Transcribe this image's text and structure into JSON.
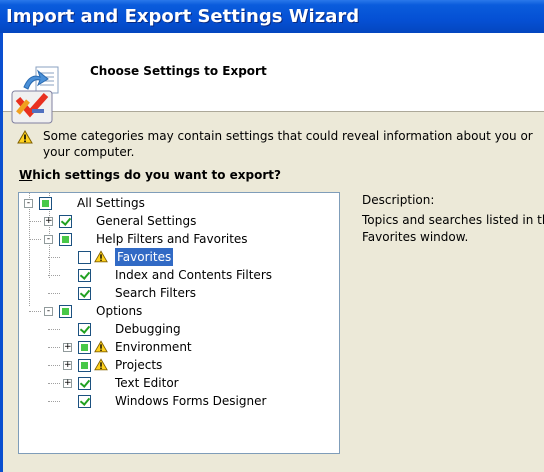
{
  "window": {
    "title": "Import and Export Settings Wizard"
  },
  "header": {
    "title": "Choose Settings to Export",
    "logo_icon": "visual-studio-logo-icon"
  },
  "warning": {
    "icon": "warning-icon",
    "text": "Some categories may contain settings that could reveal information about you or your computer."
  },
  "question": {
    "mnemonic": "W",
    "rest": "hich settings do you want to export?"
  },
  "tree": {
    "nodes": [
      {
        "label": "All Settings",
        "state": "partial",
        "expander": "-",
        "warn": false,
        "level": 0
      },
      {
        "label": "General Settings",
        "state": "checked",
        "expander": "+",
        "warn": false,
        "level": 1
      },
      {
        "label": "Help Filters and Favorites",
        "state": "partial",
        "expander": "-",
        "warn": false,
        "level": 1
      },
      {
        "label": "Favorites",
        "state": "unchecked",
        "expander": "",
        "warn": true,
        "selected": true,
        "level": 2
      },
      {
        "label": "Index and Contents Filters",
        "state": "checked",
        "expander": "",
        "warn": false,
        "level": 2
      },
      {
        "label": "Search Filters",
        "state": "checked",
        "expander": "",
        "warn": false,
        "level": 2
      },
      {
        "label": "Options",
        "state": "partial",
        "expander": "-",
        "warn": false,
        "level": 1
      },
      {
        "label": "Debugging",
        "state": "checked",
        "expander": "",
        "warn": false,
        "level": 2
      },
      {
        "label": "Environment",
        "state": "partial",
        "expander": "+",
        "warn": true,
        "level": 2
      },
      {
        "label": "Projects",
        "state": "partial",
        "expander": "+",
        "warn": true,
        "level": 2
      },
      {
        "label": "Text Editor",
        "state": "checked",
        "expander": "+",
        "warn": false,
        "level": 2
      },
      {
        "label": "Windows Forms Designer",
        "state": "checked",
        "expander": "",
        "warn": false,
        "level": 2
      }
    ]
  },
  "description": {
    "label": "Description:",
    "text": "Topics and searches listed in the Favorites window."
  },
  "colors": {
    "titlebar": "#0550d4",
    "selection": "#316ac5",
    "dialog": "#ece9d8"
  }
}
